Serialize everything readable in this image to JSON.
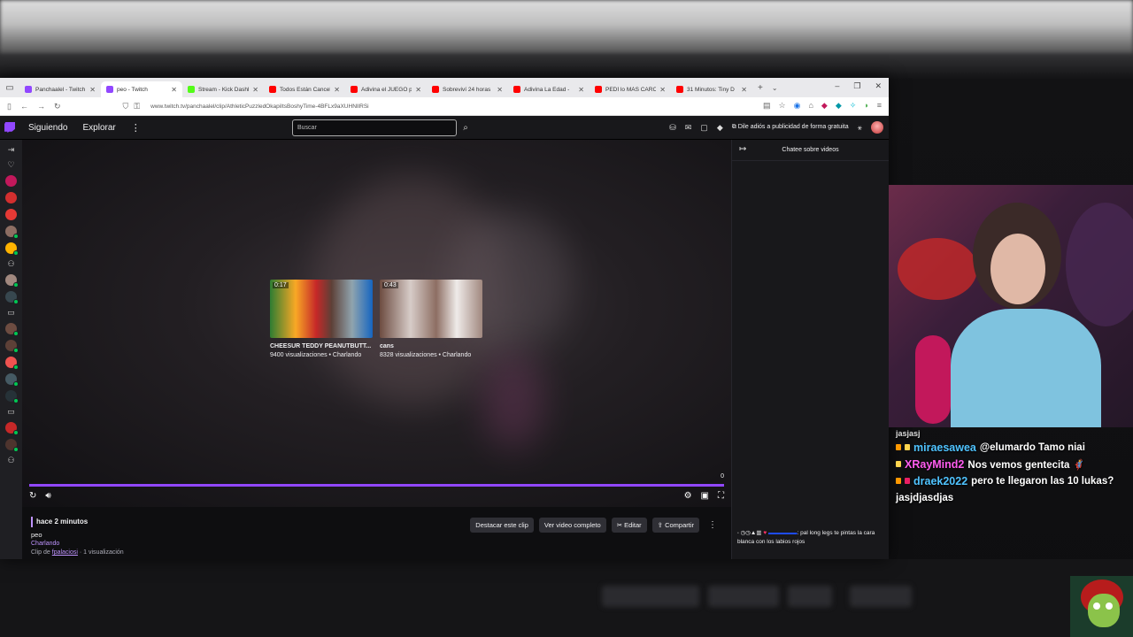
{
  "browser": {
    "tabs": [
      {
        "title": "Panchaalel - Twitch",
        "color": "#9147ff",
        "active": false
      },
      {
        "title": "peo - Twitch",
        "color": "#9147ff",
        "active": true
      },
      {
        "title": "Stream - Kick Dashboar",
        "color": "#53fc18",
        "active": false
      },
      {
        "title": "Todos Están Cancelando",
        "color": "#ff0000",
        "active": false
      },
      {
        "title": "Adivina el JUEGO por l",
        "color": "#ff0000",
        "active": false
      },
      {
        "title": "Sobreviví 24 horas",
        "color": "#ff0000",
        "active": false
      },
      {
        "title": "Adivina La Edad -",
        "color": "#ff0000",
        "active": false
      },
      {
        "title": "PEDÍ lo MÁS CARO",
        "color": "#ff0000",
        "active": false
      },
      {
        "title": "31 Minutos: Tiny D",
        "color": "#ff0000",
        "active": false
      }
    ],
    "url": "www.twitch.tv/panchaalel/clip/AthleticPuzzledOkapiItsBoshyTime-4BFLx9aXUHNlIRSi"
  },
  "twitch": {
    "nav": {
      "following": "Siguiendo",
      "explore": "Explorar"
    },
    "search": {
      "placeholder": "Buscar"
    },
    "ads_label": "Dile adiós a publicidad de forma gratuita"
  },
  "player": {
    "recommendations": [
      {
        "duration": "0:17",
        "title": "CHEESUR TEDDY PEANUTBUTT...",
        "meta": "9400 visualizaciones • Charlando"
      },
      {
        "duration": "0:43",
        "title": "cans",
        "meta": "8328 visualizaciones • Charlando"
      }
    ],
    "counter": "0",
    "progress": 1.0
  },
  "clip": {
    "time_ago": "hace 2 minutos",
    "title": "peo",
    "category": "Charlando",
    "clip_by_prefix": "Clip de",
    "clipper": "fpalaciosi",
    "views": "· 1 visualización",
    "actions": {
      "feature": "Destacar este clip",
      "full_video": "Ver video completo",
      "edit": "Editar",
      "share": "Compartir"
    }
  },
  "chat_panel": {
    "title": "Chatee sobre videos",
    "message": {
      "text": ": pal long legs te pintas la cara blanca con los labios rojos"
    }
  },
  "overlay_chat": {
    "partial": "jasjasj",
    "lines": [
      {
        "user": "miraesawea",
        "color": "#4fc3ff",
        "text": "@elumardo Tamo niai"
      },
      {
        "user": "XRayMind2",
        "color": "#ff5cf0",
        "text": "Nos vemos gentecita 🦸"
      },
      {
        "user": "draek2022",
        "color": "#4fc3ff",
        "text": "pero te llegaron las 10 lukas?"
      },
      {
        "user": "",
        "color": "#ffffff",
        "text": "jasjdjasdjas"
      }
    ]
  },
  "colors": {
    "twitch_purple": "#9147ff",
    "link_purple": "#bf94ff"
  }
}
